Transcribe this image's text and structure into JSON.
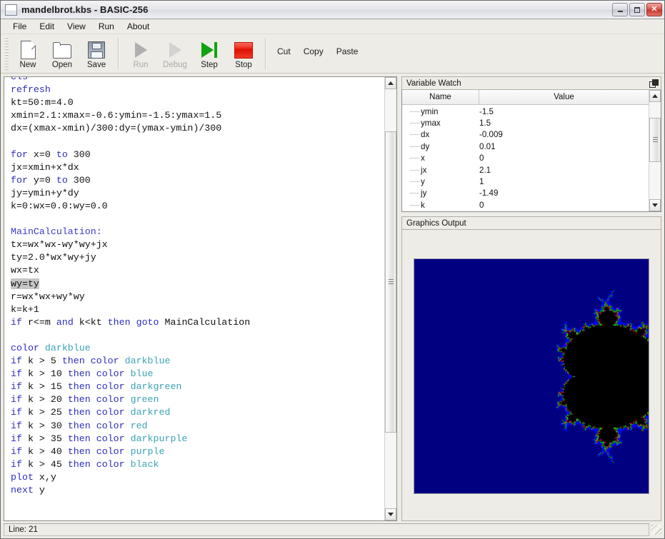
{
  "window": {
    "title": "mandelbrot.kbs - BASIC-256",
    "icon": "document-window-icon",
    "minimize_label": "–",
    "maximize_label": "□",
    "close_label": "✕"
  },
  "menubar": {
    "items": [
      {
        "label": "File"
      },
      {
        "label": "Edit"
      },
      {
        "label": "View"
      },
      {
        "label": "Run"
      },
      {
        "label": "About"
      }
    ]
  },
  "toolbar": {
    "buttons": [
      {
        "label": "New",
        "icon": "new-file-icon",
        "enabled": true
      },
      {
        "label": "Open",
        "icon": "open-folder-icon",
        "enabled": true
      },
      {
        "label": "Save",
        "icon": "floppy-disk-icon",
        "enabled": true
      },
      {
        "label": "Run",
        "icon": "play-triangle-icon",
        "enabled": false
      },
      {
        "label": "Debug",
        "icon": "debug-triangle-icon",
        "enabled": false
      },
      {
        "label": "Step",
        "icon": "step-over-icon",
        "enabled": true
      },
      {
        "label": "Stop",
        "icon": "stop-square-icon",
        "enabled": true
      }
    ],
    "text_buttons": [
      {
        "label": "Cut"
      },
      {
        "label": "Copy"
      },
      {
        "label": "Paste"
      }
    ]
  },
  "editor": {
    "lines": [
      {
        "tokens": [
          {
            "t": "cls",
            "c": "kw"
          }
        ],
        "clipped": true
      },
      {
        "tokens": [
          {
            "t": "refresh",
            "c": "kw"
          }
        ]
      },
      {
        "tokens": [
          {
            "t": "kt=50:m=4.0",
            "c": ""
          }
        ]
      },
      {
        "tokens": [
          {
            "t": "xmin=2.1:xmax=-0.6:ymin=-1.5:ymax=1.5",
            "c": ""
          }
        ]
      },
      {
        "tokens": [
          {
            "t": "dx=(xmax-xmin)/300:dy=(ymax-ymin)/300",
            "c": ""
          }
        ]
      },
      {
        "tokens": [
          {
            "t": "",
            "c": ""
          }
        ]
      },
      {
        "tokens": [
          {
            "t": "for",
            "c": "kw"
          },
          {
            "t": " x=0 ",
            "c": ""
          },
          {
            "t": "to",
            "c": "kw"
          },
          {
            "t": " 300",
            "c": ""
          }
        ]
      },
      {
        "tokens": [
          {
            "t": "jx=xmin+x*dx",
            "c": ""
          }
        ]
      },
      {
        "tokens": [
          {
            "t": "for",
            "c": "kw"
          },
          {
            "t": " y=0 ",
            "c": ""
          },
          {
            "t": "to",
            "c": "kw"
          },
          {
            "t": " 300",
            "c": ""
          }
        ]
      },
      {
        "tokens": [
          {
            "t": "jy=ymin+y*dy",
            "c": ""
          }
        ]
      },
      {
        "tokens": [
          {
            "t": "k=0:wx=0.0:wy=0.0",
            "c": ""
          }
        ]
      },
      {
        "tokens": [
          {
            "t": "",
            "c": ""
          }
        ]
      },
      {
        "tokens": [
          {
            "t": "MainCalculation:",
            "c": "lbl"
          }
        ]
      },
      {
        "tokens": [
          {
            "t": "tx=wx*wx-wy*wy+jx",
            "c": ""
          }
        ]
      },
      {
        "tokens": [
          {
            "t": "ty=2.0*wx*wy+jy",
            "c": ""
          }
        ]
      },
      {
        "tokens": [
          {
            "t": "wx=tx",
            "c": ""
          }
        ]
      },
      {
        "tokens": [
          {
            "t": "wy=ty",
            "c": "sel"
          }
        ]
      },
      {
        "tokens": [
          {
            "t": "r=wx*wx+wy*wy",
            "c": ""
          }
        ]
      },
      {
        "tokens": [
          {
            "t": "k=k+1",
            "c": ""
          }
        ]
      },
      {
        "tokens": [
          {
            "t": "if",
            "c": "kw"
          },
          {
            "t": " r<=m ",
            "c": ""
          },
          {
            "t": "and",
            "c": "kw"
          },
          {
            "t": " k<kt ",
            "c": ""
          },
          {
            "t": "then goto",
            "c": "kw"
          },
          {
            "t": " MainCalculation",
            "c": ""
          }
        ]
      },
      {
        "tokens": [
          {
            "t": "",
            "c": ""
          }
        ]
      },
      {
        "tokens": [
          {
            "t": "color",
            "c": "kw"
          },
          {
            "t": " ",
            "c": ""
          },
          {
            "t": "darkblue",
            "c": "clr"
          }
        ]
      },
      {
        "tokens": [
          {
            "t": "if",
            "c": "kw"
          },
          {
            "t": " k > 5 ",
            "c": ""
          },
          {
            "t": "then color",
            "c": "kw"
          },
          {
            "t": " ",
            "c": ""
          },
          {
            "t": "darkblue",
            "c": "clr"
          }
        ]
      },
      {
        "tokens": [
          {
            "t": "if",
            "c": "kw"
          },
          {
            "t": " k > 10 ",
            "c": ""
          },
          {
            "t": "then color",
            "c": "kw"
          },
          {
            "t": " ",
            "c": ""
          },
          {
            "t": "blue",
            "c": "clr"
          }
        ]
      },
      {
        "tokens": [
          {
            "t": "if",
            "c": "kw"
          },
          {
            "t": " k > 15 ",
            "c": ""
          },
          {
            "t": "then color",
            "c": "kw"
          },
          {
            "t": " ",
            "c": ""
          },
          {
            "t": "darkgreen",
            "c": "clr"
          }
        ]
      },
      {
        "tokens": [
          {
            "t": "if",
            "c": "kw"
          },
          {
            "t": " k > 20 ",
            "c": ""
          },
          {
            "t": "then color",
            "c": "kw"
          },
          {
            "t": " ",
            "c": ""
          },
          {
            "t": "green",
            "c": "clr"
          }
        ]
      },
      {
        "tokens": [
          {
            "t": "if",
            "c": "kw"
          },
          {
            "t": " k > 25 ",
            "c": ""
          },
          {
            "t": "then color",
            "c": "kw"
          },
          {
            "t": " ",
            "c": ""
          },
          {
            "t": "darkred",
            "c": "clr"
          }
        ]
      },
      {
        "tokens": [
          {
            "t": "if",
            "c": "kw"
          },
          {
            "t": " k > 30 ",
            "c": ""
          },
          {
            "t": "then color",
            "c": "kw"
          },
          {
            "t": " ",
            "c": ""
          },
          {
            "t": "red",
            "c": "clr"
          }
        ]
      },
      {
        "tokens": [
          {
            "t": "if",
            "c": "kw"
          },
          {
            "t": " k > 35 ",
            "c": ""
          },
          {
            "t": "then color",
            "c": "kw"
          },
          {
            "t": " ",
            "c": ""
          },
          {
            "t": "darkpurple",
            "c": "clr"
          }
        ]
      },
      {
        "tokens": [
          {
            "t": "if",
            "c": "kw"
          },
          {
            "t": " k > 40 ",
            "c": ""
          },
          {
            "t": "then color",
            "c": "kw"
          },
          {
            "t": " ",
            "c": ""
          },
          {
            "t": "purple",
            "c": "clr"
          }
        ]
      },
      {
        "tokens": [
          {
            "t": "if",
            "c": "kw"
          },
          {
            "t": " k > 45 ",
            "c": ""
          },
          {
            "t": "then color",
            "c": "kw"
          },
          {
            "t": " ",
            "c": ""
          },
          {
            "t": "black",
            "c": "clr"
          }
        ]
      },
      {
        "tokens": [
          {
            "t": "plot",
            "c": "kw"
          },
          {
            "t": " x,y",
            "c": ""
          }
        ]
      },
      {
        "tokens": [
          {
            "t": "next",
            "c": "kw"
          },
          {
            "t": " y",
            "c": ""
          }
        ]
      }
    ],
    "selection": "wy=ty"
  },
  "variable_watch": {
    "title": "Variable Watch",
    "float_icon": "undock-window-icon",
    "columns": [
      "Name",
      "Value"
    ],
    "rows": [
      {
        "name": "ymin",
        "value": "-1.5"
      },
      {
        "name": "ymax",
        "value": "1.5"
      },
      {
        "name": "dx",
        "value": "-0.009"
      },
      {
        "name": "dy",
        "value": "0.01"
      },
      {
        "name": "x",
        "value": "0"
      },
      {
        "name": "jx",
        "value": "2.1"
      },
      {
        "name": "y",
        "value": "1"
      },
      {
        "name": "jy",
        "value": "-1.49"
      },
      {
        "name": "k",
        "value": "0"
      }
    ]
  },
  "graphics_output": {
    "title": "Graphics Output",
    "background_color": "#000080",
    "fractal": "mandelbrot-set",
    "mirrored_x": true,
    "params": {
      "xmin": 2.1,
      "xmax": -0.6,
      "ymin": -1.5,
      "ymax": 1.5,
      "max_iterations": 50,
      "escape_radius_sq": 4.0,
      "size": 300
    },
    "palette": [
      {
        "threshold": 0,
        "name": "darkblue",
        "hex": "#000080"
      },
      {
        "threshold": 5,
        "name": "darkblue",
        "hex": "#000080"
      },
      {
        "threshold": 10,
        "name": "blue",
        "hex": "#0000ff"
      },
      {
        "threshold": 15,
        "name": "darkgreen",
        "hex": "#008000"
      },
      {
        "threshold": 20,
        "name": "green",
        "hex": "#00ff00"
      },
      {
        "threshold": 25,
        "name": "darkred",
        "hex": "#800000"
      },
      {
        "threshold": 30,
        "name": "red",
        "hex": "#ff0000"
      },
      {
        "threshold": 35,
        "name": "darkpurple",
        "hex": "#800080"
      },
      {
        "threshold": 40,
        "name": "purple",
        "hex": "#ff00ff"
      },
      {
        "threshold": 45,
        "name": "black",
        "hex": "#000000"
      }
    ]
  },
  "statusbar": {
    "text": "Line: 21"
  }
}
